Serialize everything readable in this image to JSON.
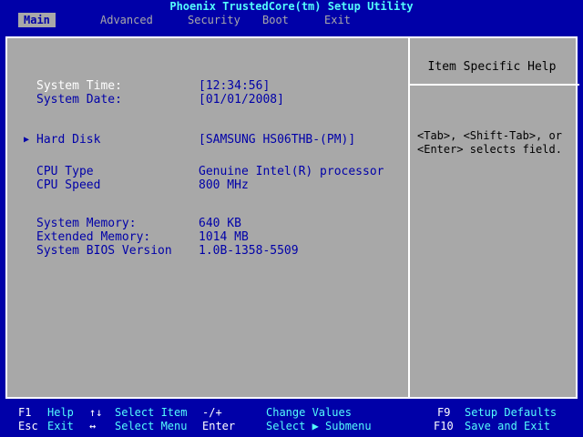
{
  "title": "Phoenix TrustedCore(tm) Setup Utility",
  "menu": [
    "Main",
    "Advanced",
    "Security",
    "Boot",
    "Exit"
  ],
  "fields": {
    "system_time_label": "System Time:",
    "system_time_value": "[12:34:56]",
    "system_date_label": "System Date:",
    "system_date_value": "[01/01/2008]",
    "hard_disk_label": "Hard Disk",
    "hard_disk_value": "[SAMSUNG HS06THB-(PM)]",
    "cpu_type_label": "CPU Type",
    "cpu_type_value": "Genuine Intel(R) processor",
    "cpu_speed_label": "CPU Speed",
    "cpu_speed_value": "800 MHz",
    "system_memory_label": "System Memory:",
    "system_memory_value": "640 KB",
    "extended_memory_label": "Extended Memory:",
    "extended_memory_value": "1014 MB",
    "bios_version_label": "System BIOS Version",
    "bios_version_value": "1.0B-1358-5509"
  },
  "help": {
    "title": "Item Specific Help",
    "text": "<Tab>, <Shift-Tab>, or\n<Enter> selects field."
  },
  "footer": {
    "row1": [
      {
        "key": "F1",
        "desc": "Help"
      },
      {
        "key": "↑↓",
        "desc": "Select Item"
      },
      {
        "key": "-/+",
        "desc": "Change Values"
      },
      {
        "key": "F9",
        "desc": "Setup Defaults"
      }
    ],
    "row2": [
      {
        "key": "Esc",
        "desc": "Exit"
      },
      {
        "key": "",
        "desc": "Select Menu"
      },
      {
        "key": "Enter",
        "desc": "Select ▶ Submenu"
      },
      {
        "key": "F10",
        "desc": "Save and Exit"
      }
    ]
  },
  "colors": {
    "background": "#0000a8",
    "panel": "#a8a8a8",
    "highlight": "#ffffff",
    "cyan": "#54fcfc"
  }
}
